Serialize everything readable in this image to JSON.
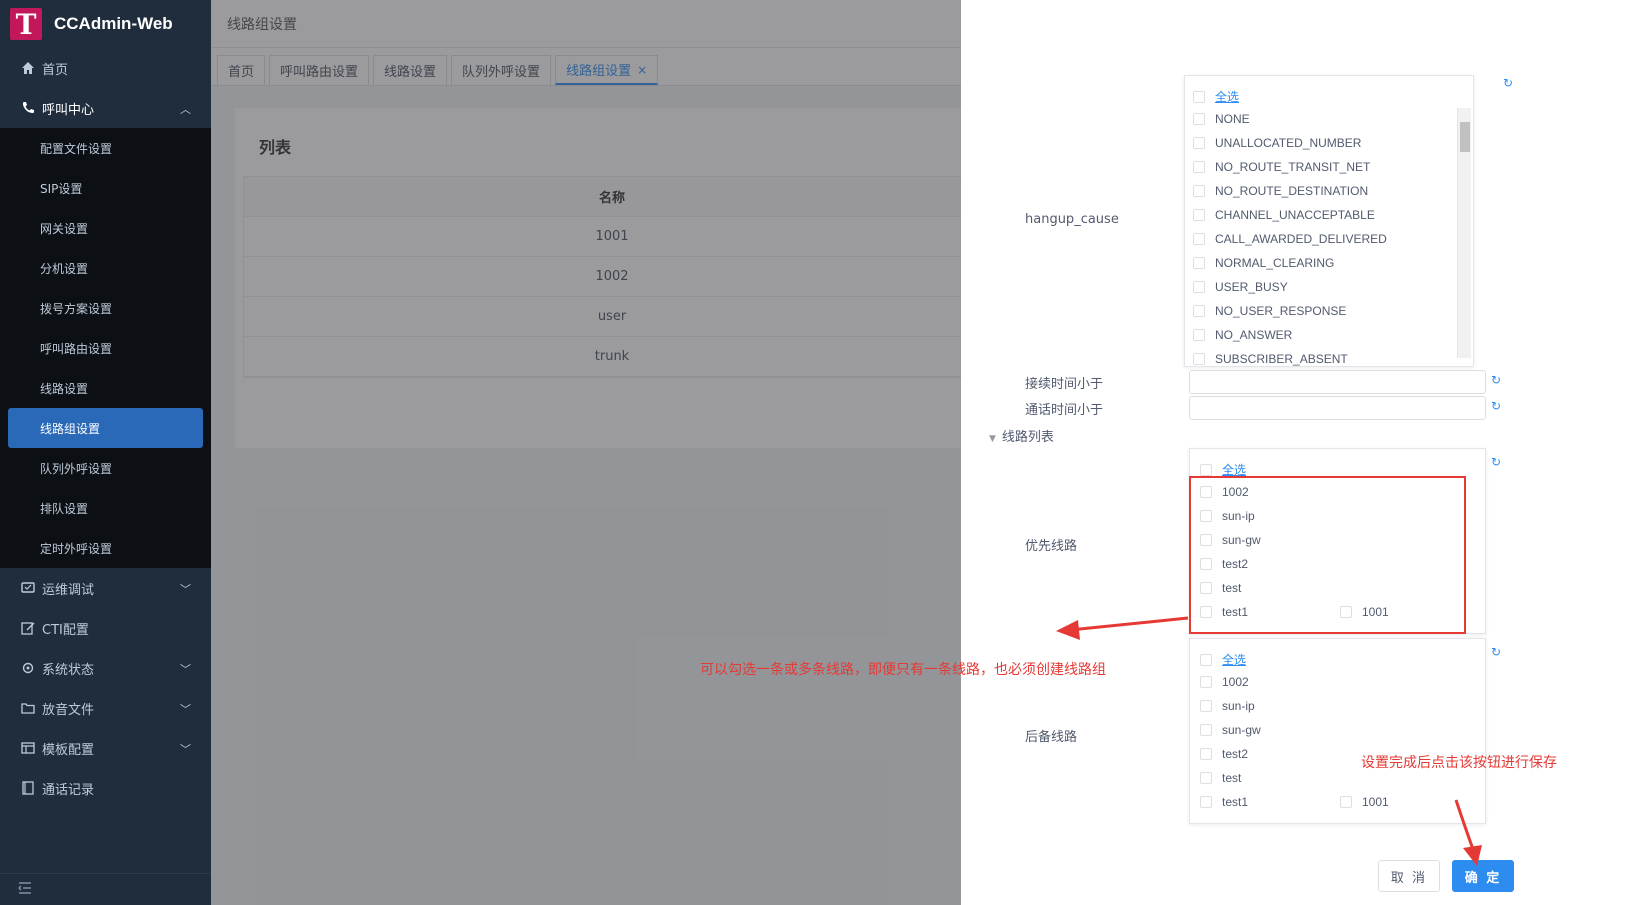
{
  "app": {
    "logo_letter": "T",
    "title": "CCAdmin-Web"
  },
  "sidebar": {
    "items": [
      {
        "label": "首页",
        "icon": "home-icon"
      },
      {
        "label": "呼叫中心",
        "icon": "phone-icon",
        "expanded": true,
        "children": [
          "配置文件设置",
          "SIP设置",
          "网关设置",
          "分机设置",
          "拨号方案设置",
          "呼叫路由设置",
          "线路设置",
          "线路组设置",
          "队列外呼设置",
          "排队设置",
          "定时外呼设置"
        ],
        "active_child": "线路组设置"
      },
      {
        "label": "运维调试",
        "icon": "monitor-icon"
      },
      {
        "label": "CTI配置",
        "icon": "edit-icon"
      },
      {
        "label": "系统状态",
        "icon": "gear-icon"
      },
      {
        "label": "放音文件",
        "icon": "folder-icon"
      },
      {
        "label": "模板配置",
        "icon": "template-icon"
      },
      {
        "label": "通话记录",
        "icon": "record-icon"
      }
    ],
    "collapse_icon": "collapse-icon"
  },
  "header": {
    "page_title": "线路组设置"
  },
  "tabs": [
    {
      "label": "首页"
    },
    {
      "label": "呼叫路由设置"
    },
    {
      "label": "线路设置"
    },
    {
      "label": "队列外呼设置"
    },
    {
      "label": "线路组设置",
      "active": true,
      "close": "×"
    }
  ],
  "list": {
    "title": "列表",
    "column": "名称",
    "rows": [
      "1001",
      "1002",
      "user",
      "trunk"
    ]
  },
  "drawer": {
    "hangup_cause": {
      "label": "hangup_cause",
      "select_all": "全选",
      "options": [
        "NONE",
        "UNALLOCATED_NUMBER",
        "NO_ROUTE_TRANSIT_NET",
        "NO_ROUTE_DESTINATION",
        "CHANNEL_UNACCEPTABLE",
        "CALL_AWARDED_DELIVERED",
        "NORMAL_CLEARING",
        "USER_BUSY",
        "NO_USER_RESPONSE",
        "NO_ANSWER",
        "SUBSCRIBER_ABSENT"
      ]
    },
    "connect_time_label": "接续时间小于",
    "talk_time_label": "通话时间小于",
    "line_list_label": "线路列表",
    "primary": {
      "label": "优先线路",
      "select_all": "全选",
      "options": [
        "1002",
        "sun-ip",
        "sun-gw",
        "test2",
        "test",
        "test1"
      ],
      "extra_option": "1001"
    },
    "backup": {
      "label": "后备线路",
      "select_all": "全选",
      "options": [
        "1002",
        "sun-ip",
        "sun-gw",
        "test2",
        "test",
        "test1"
      ],
      "extra_option": "1001"
    },
    "cancel_label": "取 消",
    "ok_label": "确 定"
  },
  "annotations": {
    "multi_select_note": "可以勾选一条或多条线路，即便只有一条线路，也必须创建线路组",
    "save_note": "设置完成后点击该按钮进行保存",
    "color": "#e53935"
  },
  "colors": {
    "sidebar": "#1f2d3d",
    "accent": "#2d8cf0",
    "active_menu": "#2a68b8"
  }
}
